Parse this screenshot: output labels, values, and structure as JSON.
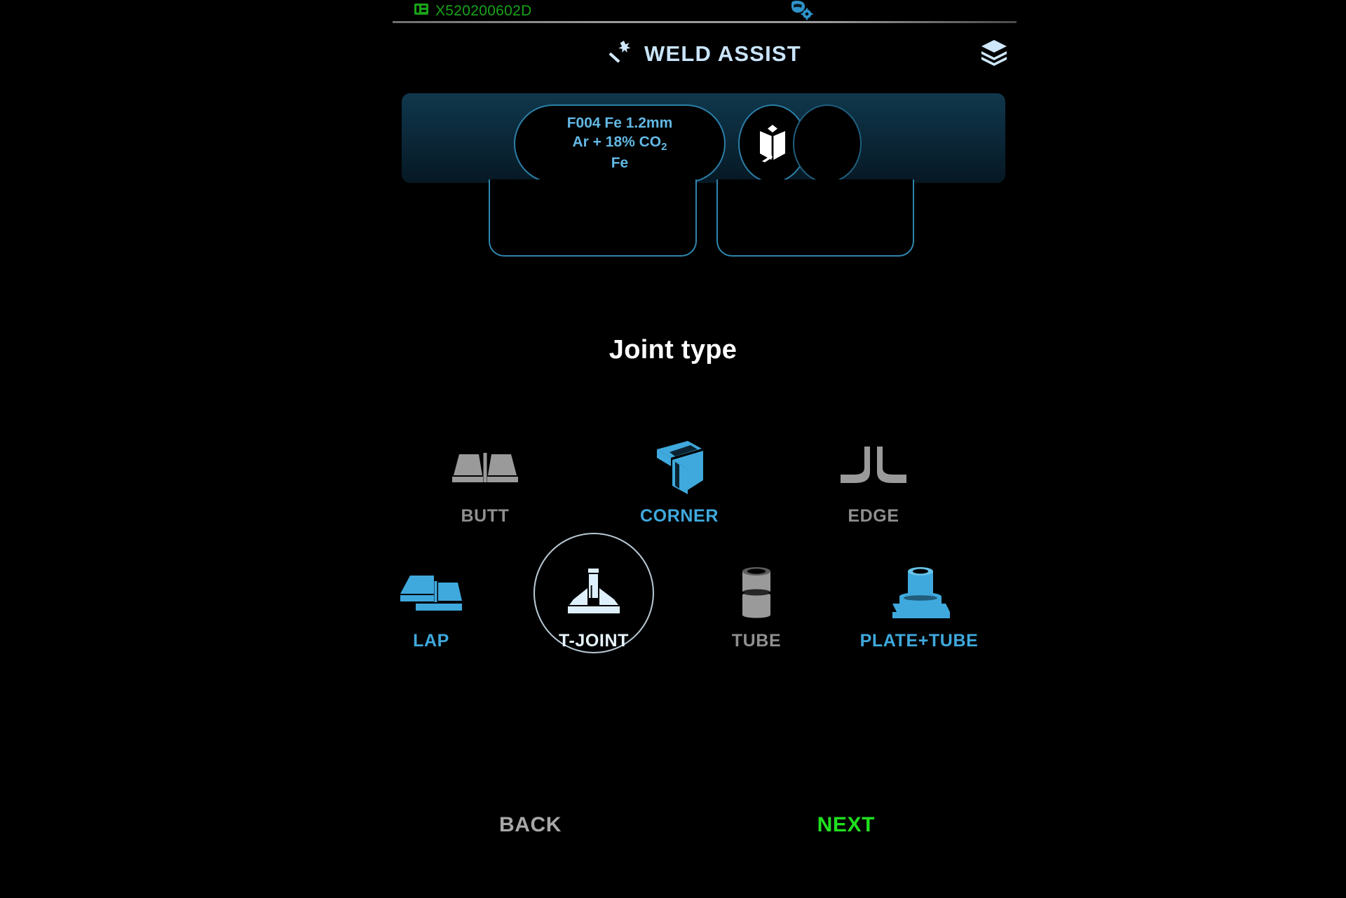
{
  "status_bar": {
    "machine_id": "X520200602D",
    "machine_icon": "welder-machine-icon",
    "helmet_icon": "welding-helmet-settings-icon"
  },
  "header": {
    "title": "WELD ASSIST",
    "wand_icon": "magic-wand-icon",
    "layers_icon": "layers-icon"
  },
  "info_panel": {
    "consumable": {
      "line1": "F004 Fe 1.2mm",
      "line2_prefix": "Ar + 18% CO",
      "line2_sub": "2",
      "line3": "Fe"
    },
    "manual_button_icon": "open-book-icon",
    "blank_button_label": ""
  },
  "joint_section": {
    "heading": "Joint type",
    "options": [
      {
        "id": "butt",
        "label": "BUTT",
        "icon": "butt-joint-icon",
        "state": "dim",
        "selected": false
      },
      {
        "id": "corner",
        "label": "CORNER",
        "icon": "corner-joint-icon",
        "state": "active",
        "selected": false
      },
      {
        "id": "edge",
        "label": "EDGE",
        "icon": "edge-joint-icon",
        "state": "dim",
        "selected": false
      },
      {
        "id": "lap",
        "label": "LAP",
        "icon": "lap-joint-icon",
        "state": "active",
        "selected": false
      },
      {
        "id": "t-joint",
        "label": "T-JOINT",
        "icon": "t-joint-icon",
        "state": "selected",
        "selected": true
      },
      {
        "id": "tube",
        "label": "TUBE",
        "icon": "tube-joint-icon",
        "state": "dim",
        "selected": false
      },
      {
        "id": "plate-tube",
        "label": "PLATE+TUBE",
        "icon": "plate-tube-joint-icon",
        "state": "active",
        "selected": false
      }
    ]
  },
  "footer": {
    "back_label": "BACK",
    "next_label": "NEXT"
  },
  "colors": {
    "accent_blue": "#3fa9dd",
    "dim_gray": "#8f8f8f",
    "selected_white": "#e8f4fc",
    "next_green": "#1fe01f",
    "machine_id_green": "#19a219",
    "title_blue": "#c9e4fb",
    "panel_border": "#2b7fa8"
  }
}
